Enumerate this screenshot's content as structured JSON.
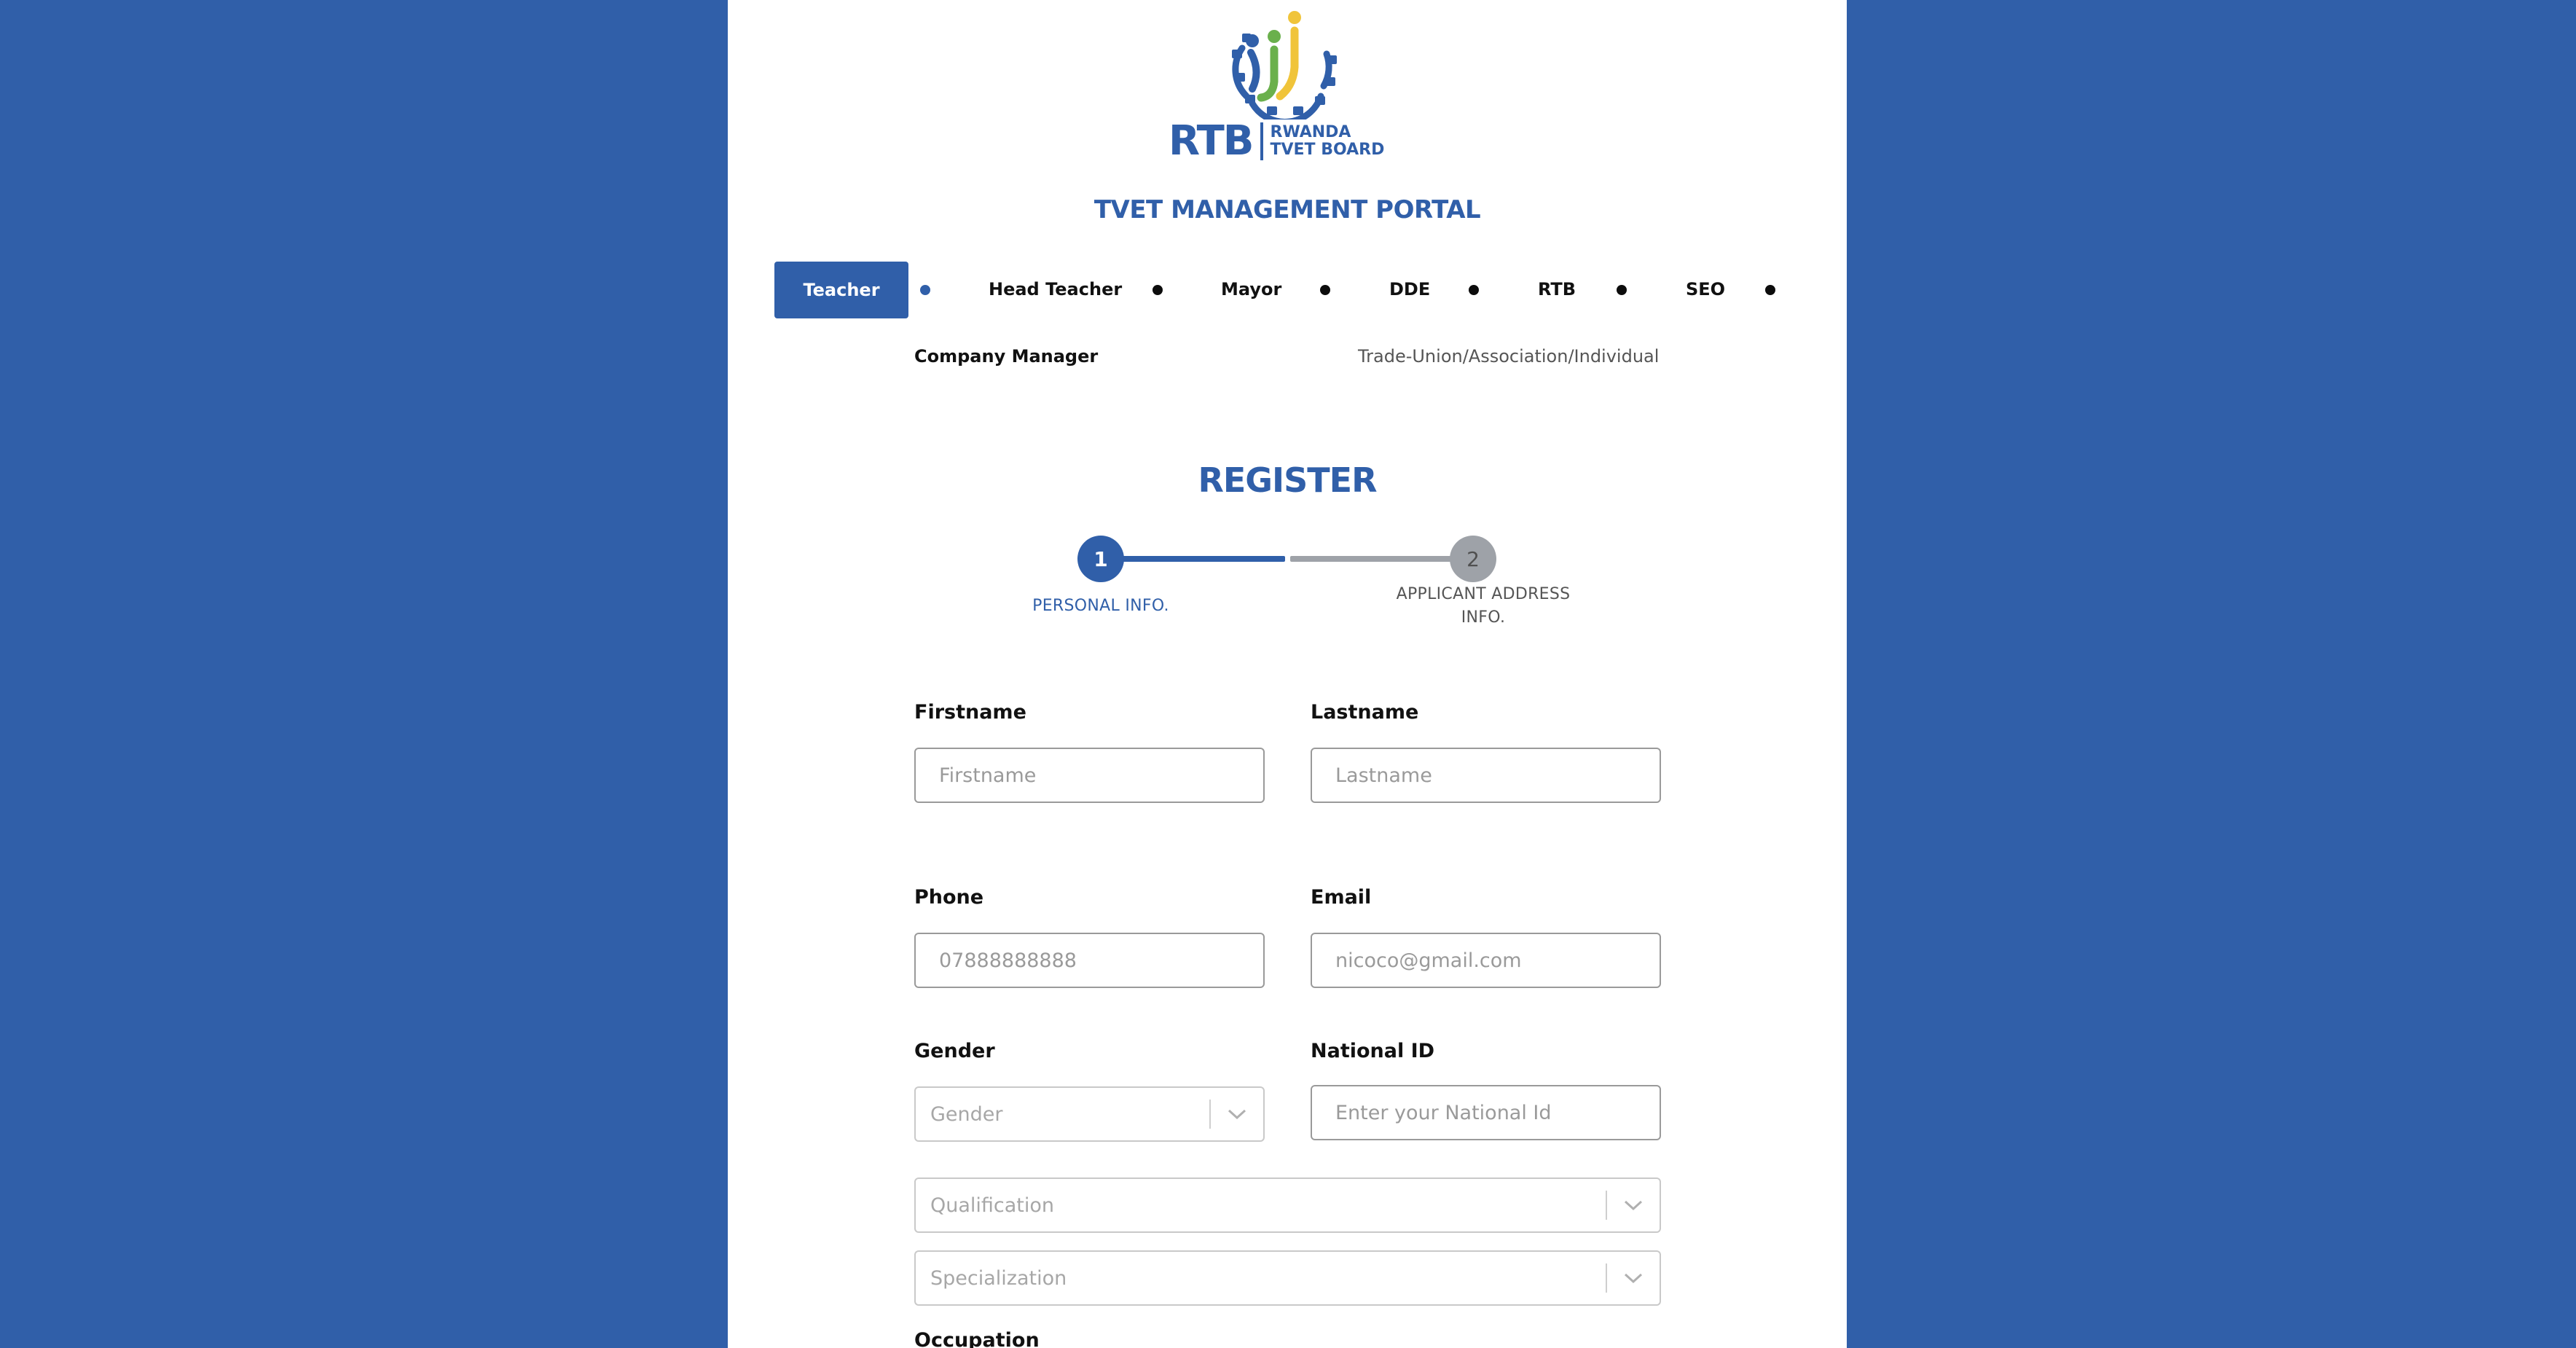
{
  "portal": {
    "brand_abbr": "RTB",
    "brand_line1": "RWANDA",
    "brand_line2": "TVET BOARD",
    "title": "TVET MANAGEMENT PORTAL"
  },
  "roles": [
    {
      "label": "Teacher",
      "active": true
    },
    {
      "label": "Head Teacher",
      "active": false
    },
    {
      "label": "Mayor",
      "active": false
    },
    {
      "label": "DDE",
      "active": false
    },
    {
      "label": "RTB",
      "active": false
    },
    {
      "label": "SEO",
      "active": false
    },
    {
      "label": "Company Manager",
      "active": false
    },
    {
      "label": "Trade-Union/Association/Individual",
      "active": false
    }
  ],
  "register": {
    "title": "REGISTER",
    "steps": [
      {
        "number": "1",
        "label_line1": "PERSONAL INFO.",
        "label_line2": "",
        "state": "active"
      },
      {
        "number": "2",
        "label_line1": "APPLICANT ADDRESS",
        "label_line2": "INFO.",
        "state": "pending"
      }
    ]
  },
  "form": {
    "firstname": {
      "label": "Firstname",
      "placeholder": "Firstname"
    },
    "lastname": {
      "label": "Lastname",
      "placeholder": "Lastname"
    },
    "phone": {
      "label": "Phone",
      "placeholder": "07888888888"
    },
    "email": {
      "label": "Email",
      "placeholder": "nicoco@gmail.com"
    },
    "gender": {
      "label": "Gender",
      "placeholder": "Gender"
    },
    "national_id": {
      "label": "National ID",
      "placeholder": "Enter your National Id"
    },
    "qualification": {
      "placeholder": "Qualification"
    },
    "specialization": {
      "placeholder": "Specialization"
    },
    "occupation": {
      "label": "Occupation"
    }
  },
  "colors": {
    "brand_blue": "#305fa9",
    "logo_green": "#6ab04c",
    "logo_yellow": "#f0c43a",
    "step_pending": "#9ea2a8",
    "step_pending_text": "#555555"
  },
  "icons": {
    "select_arrow": "chevron-down-icon",
    "logo": "rtb-gear-logo-icon"
  }
}
